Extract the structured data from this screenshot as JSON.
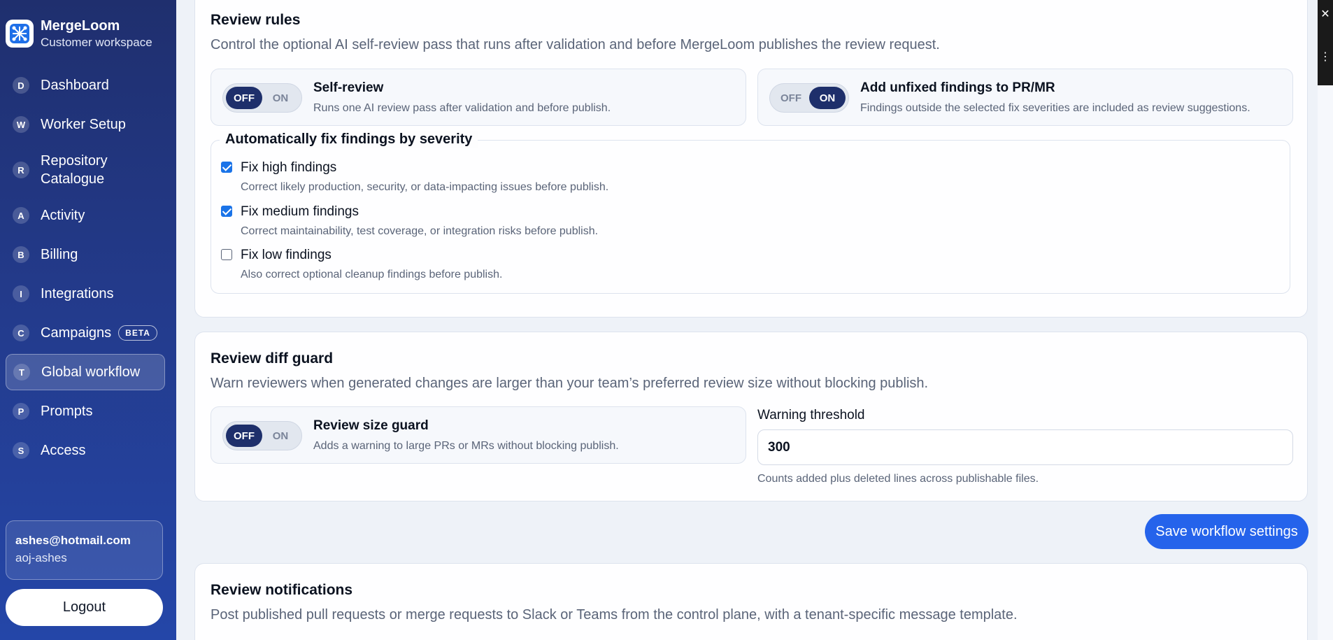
{
  "brand": {
    "name": "MergeLoom",
    "subtitle": "Customer workspace"
  },
  "nav": [
    {
      "letter": "D",
      "label": "Dashboard"
    },
    {
      "letter": "W",
      "label": "Worker Setup"
    },
    {
      "letter": "R",
      "label": "Repository Catalogue"
    },
    {
      "letter": "A",
      "label": "Activity"
    },
    {
      "letter": "B",
      "label": "Billing"
    },
    {
      "letter": "I",
      "label": "Integrations"
    },
    {
      "letter": "C",
      "label": "Campaigns",
      "badge": "BETA"
    },
    {
      "letter": "T",
      "label": "Global workflow",
      "active": true
    },
    {
      "letter": "P",
      "label": "Prompts"
    },
    {
      "letter": "S",
      "label": "Access"
    }
  ],
  "user": {
    "email": "ashes@hotmail.com",
    "username": "aoj-ashes"
  },
  "logout_label": "Logout",
  "review_rules": {
    "title": "Review rules",
    "description": "Control the optional AI self-review pass that runs after validation and before MergeLoom publishes the review request.",
    "self_review": {
      "off": "OFF",
      "on": "ON",
      "state": "OFF",
      "title": "Self-review",
      "description": "Runs one AI review pass after validation and before publish."
    },
    "unfixed": {
      "off": "OFF",
      "on": "ON",
      "state": "ON",
      "title": "Add unfixed findings to PR/MR",
      "description": "Findings outside the selected fix severities are included as review suggestions."
    },
    "severity": {
      "legend": "Automatically fix findings by severity",
      "items": [
        {
          "label": "Fix high findings",
          "description": "Correct likely production, security, or data-impacting issues before publish.",
          "checked": true
        },
        {
          "label": "Fix medium findings",
          "description": "Correct maintainability, test coverage, or integration risks before publish.",
          "checked": true
        },
        {
          "label": "Fix low findings",
          "description": "Also correct optional cleanup findings before publish.",
          "checked": false
        }
      ]
    }
  },
  "diff_guard": {
    "title": "Review diff guard",
    "description": "Warn reviewers when generated changes are larger than your team’s preferred review size without blocking publish.",
    "size_guard": {
      "off": "OFF",
      "on": "ON",
      "state": "OFF",
      "title": "Review size guard",
      "description": "Adds a warning to large PRs or MRs without blocking publish."
    },
    "threshold": {
      "label": "Warning threshold",
      "value": "300",
      "help": "Counts added plus deleted lines across publishable files."
    }
  },
  "save_label": "Save workflow settings",
  "notifications": {
    "title": "Review notifications",
    "description": "Post published pull requests or merge requests to Slack or Teams from the control plane, with a tenant-specific message template."
  },
  "rail": {
    "close": "✕",
    "menu": "⋮"
  }
}
